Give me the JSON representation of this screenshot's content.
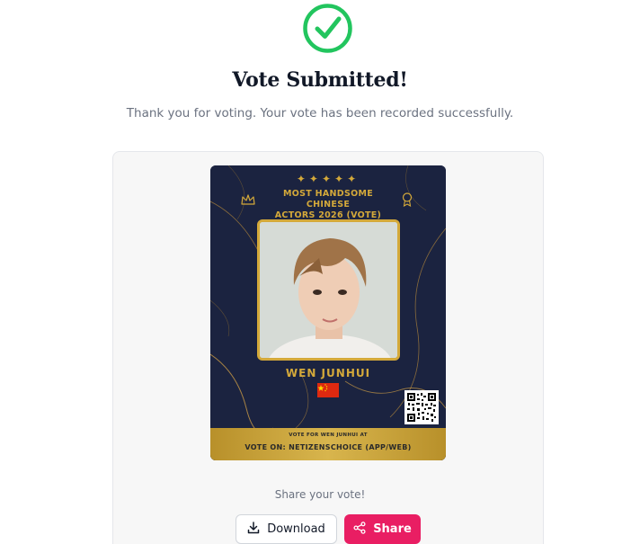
{
  "status": {
    "icon": "check-circle-icon",
    "title": "Vote Submitted!",
    "message": "Thank you for voting. Your vote has been recorded successfully.",
    "accent_color": "#22c55e"
  },
  "vote_card": {
    "stars": "✦✦✦✦✦",
    "title_line1": "MOST HANDSOME CHINESE",
    "title_line2": "ACTORS 2026 (VOTE)",
    "actor_name": "WEN JUNHUI",
    "flag": "china-flag-icon",
    "band_small_text": "VOTE FOR WEN JUNHUI AT",
    "band_main_text": "VOTE ON: NETIZENSCHOICE (APP/WEB)",
    "gold_color": "#d4a93a",
    "background_color": "#1b2340"
  },
  "share": {
    "label": "Share your vote!",
    "download_label": "Download",
    "share_label": "Share",
    "share_color": "#e91e63"
  }
}
